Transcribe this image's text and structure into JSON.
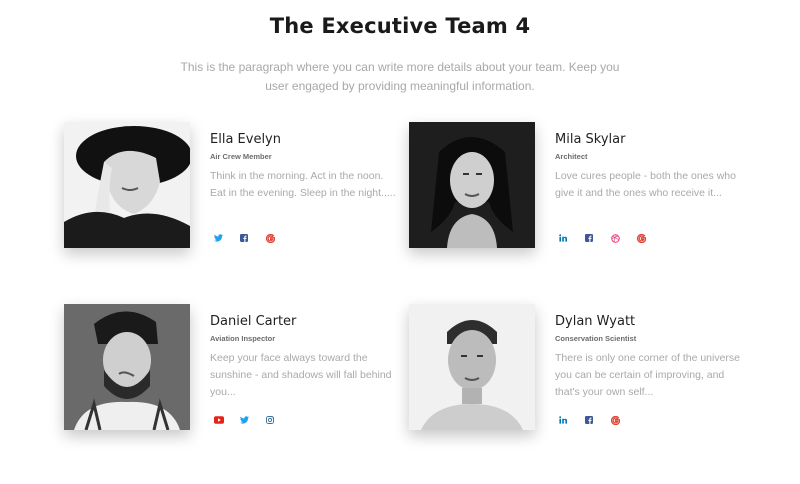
{
  "header": {
    "title": "The Executive Team 4",
    "intro": "This is the paragraph where you can write more details about your team. Keep you user engaged by providing meaningful information."
  },
  "members": [
    {
      "name": "Ella Evelyn",
      "role": "Air Crew Member",
      "bio": "Think in the morning. Act in the noon. Eat in the evening. Sleep in the night.....",
      "socials": [
        "twitter-icon",
        "facebook-icon",
        "google-icon"
      ]
    },
    {
      "name": "Mila Skylar",
      "role": "Architect",
      "bio": "Love cures people - both the ones who give it and the ones who receive it...",
      "socials": [
        "linkedin-icon",
        "facebook-icon",
        "dribbble-icon",
        "google-icon"
      ]
    },
    {
      "name": "Daniel Carter",
      "role": "Aviation Inspector",
      "bio": "Keep your face always toward the sunshine - and shadows will fall behind you...",
      "socials": [
        "youtube-icon",
        "twitter-icon",
        "instagram-icon"
      ]
    },
    {
      "name": "Dylan Wyatt",
      "role": "Conservation Scientist",
      "bio": "There is only one corner of the universe you can be certain of improving, and that's your own self...",
      "socials": [
        "linkedin-icon",
        "facebook-icon",
        "google-icon"
      ]
    }
  ],
  "colors": {
    "twitter": "#1da1f2",
    "facebook": "#3b5998",
    "google": "#e0463a",
    "linkedin": "#0077b5",
    "dribbble": "#ea4c89",
    "youtube": "#e62117",
    "instagram": "#3f729b"
  }
}
